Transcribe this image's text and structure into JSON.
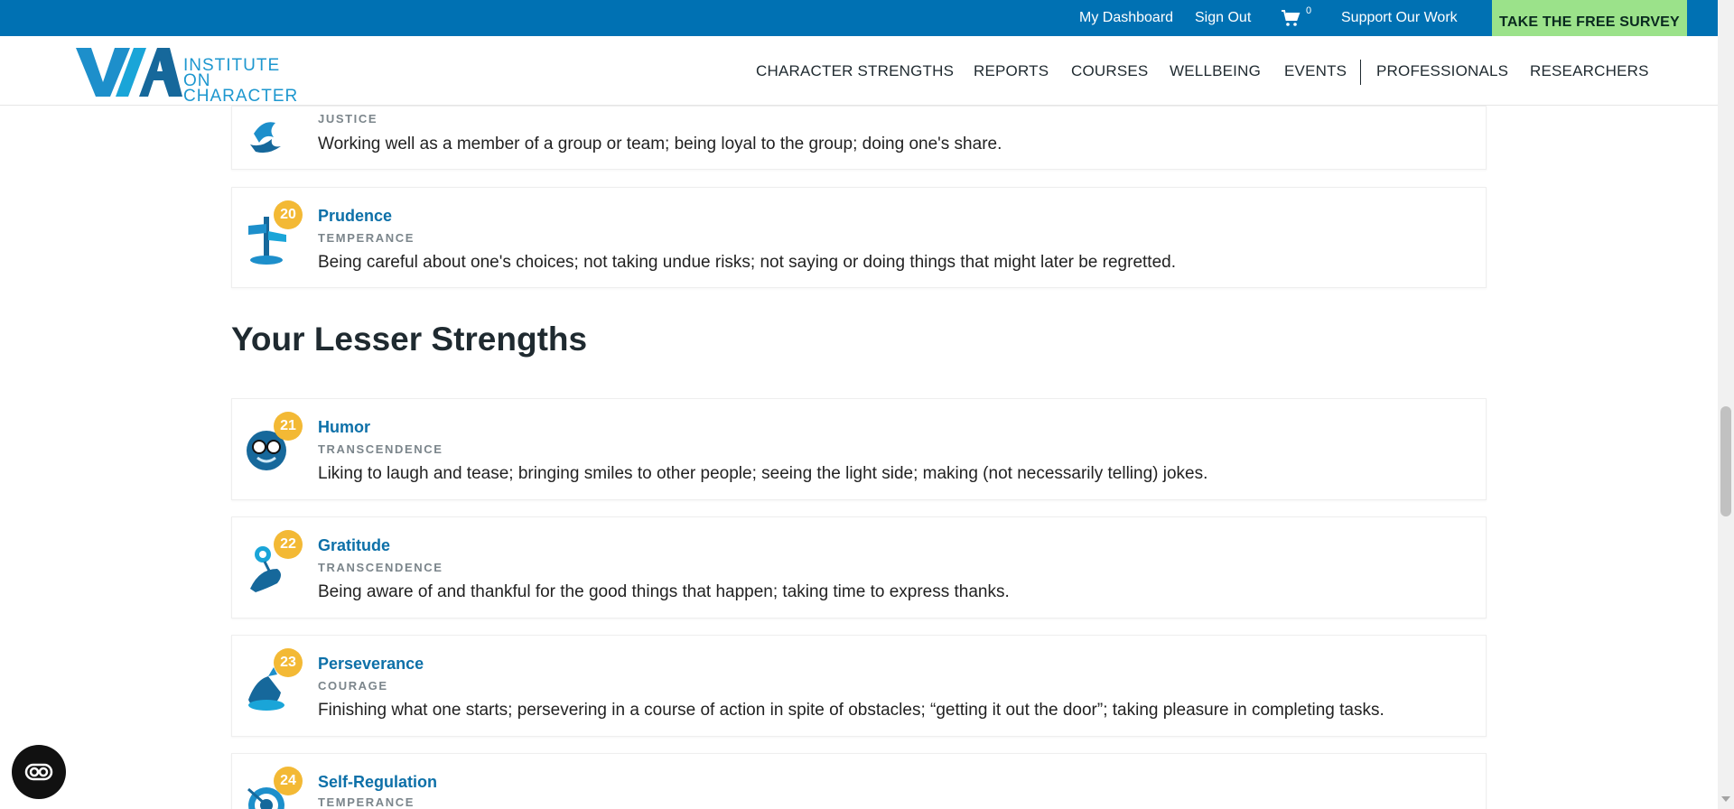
{
  "topbar": {
    "dashboard": "My Dashboard",
    "signout": "Sign Out",
    "cart_icon": "cart-icon",
    "cart_count": "0",
    "support": "Support Our Work",
    "survey_button": "TAKE THE FREE SURVEY",
    "bg_color": "#0071b3",
    "survey_color": "#9be28a"
  },
  "header": {
    "logo_line1": "INSTITUTE ON",
    "logo_line2": "CHARACTER",
    "nav": [
      "CHARACTER STRENGTHS",
      "REPORTS",
      "COURSES",
      "WELLBEING",
      "EVENTS",
      "PROFESSIONALS",
      "RESEARCHERS"
    ]
  },
  "cards_top": [
    {
      "rank": "",
      "virtue": "JUSTICE",
      "description": "Working well as a member of a group or team; being loyal to the group; doing one's share."
    },
    {
      "rank": "20",
      "name": "Prudence",
      "virtue": "TEMPERANCE",
      "description": "Being careful about one's choices; not taking undue risks; not saying or doing things that might later be regretted."
    }
  ],
  "lesser": {
    "title": "Your Lesser Strengths",
    "items": [
      {
        "rank": "21",
        "name": "Humor",
        "virtue": "TRANSCENDENCE",
        "description": "Liking to laugh and tease; bringing smiles to other people; seeing the light side; making (not necessarily telling) jokes."
      },
      {
        "rank": "22",
        "name": "Gratitude",
        "virtue": "TRANSCENDENCE",
        "description": "Being aware of and thankful for the good things that happen; taking time to express thanks."
      },
      {
        "rank": "23",
        "name": "Perseverance",
        "virtue": "COURAGE",
        "description": "Finishing what one starts; persevering in a course of action in spite of obstacles; “getting it out the door”; taking pleasure in completing tasks."
      },
      {
        "rank": "24",
        "name": "Self-Regulation",
        "virtue": "TEMPERANCE",
        "description": ""
      }
    ]
  },
  "colors": {
    "badge": "#f3b935",
    "link": "#0d70a8",
    "virtue": "#7b858b"
  }
}
